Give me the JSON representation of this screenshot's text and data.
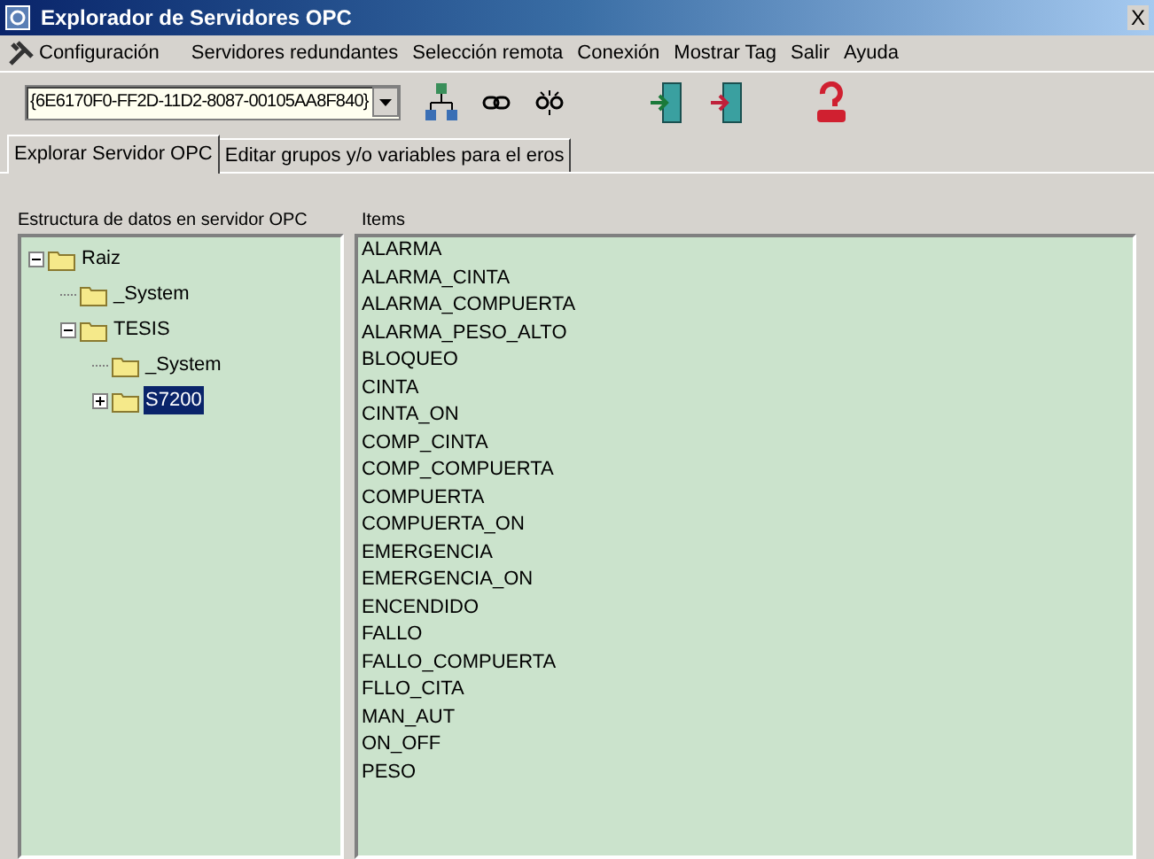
{
  "window": {
    "title": "Explorador de Servidores OPC",
    "close": "X"
  },
  "menu": [
    "Configuración",
    "Servidores redundantes",
    "Selección remota",
    "Conexión",
    "Mostrar Tag",
    "Salir",
    "Ayuda"
  ],
  "toolbar": {
    "server_combo": {
      "value": "{6E6170F0-FF2D-11D2-8087-00105AA8F840}"
    }
  },
  "tabs": [
    {
      "label": "Explorar Servidor OPC",
      "selected": true
    },
    {
      "label": "Editar grupos y/o  variables para el eros",
      "selected": false
    }
  ],
  "tree": {
    "label": "Estructura de datos en servidor OPC",
    "nodes": [
      {
        "label": "Raiz",
        "expanded": true,
        "selected": false,
        "children": [
          {
            "label": "_System",
            "selected": false
          },
          {
            "label": "TESIS",
            "expanded": true,
            "selected": false,
            "children": [
              {
                "label": "_System",
                "selected": false
              },
              {
                "label": "S7200",
                "expanded": false,
                "selected": true
              }
            ]
          }
        ]
      }
    ]
  },
  "items": {
    "label": "Items",
    "rows": [
      "ALARMA",
      "ALARMA_CINTA",
      "ALARMA_COMPUERTA",
      "ALARMA_PESO_ALTO",
      "BLOQUEO",
      "CINTA",
      "CINTA_ON",
      "COMP_CINTA",
      "COMP_COMPUERTA",
      "COMPUERTA",
      "COMPUERTA_ON",
      "EMERGENCIA",
      "EMERGENCIA_ON",
      "ENCENDIDO",
      "FALLO",
      "FALLO_COMPUERTA",
      "FLLO_CITA",
      "MAN_AUT",
      "ON_OFF",
      "PESO"
    ]
  }
}
